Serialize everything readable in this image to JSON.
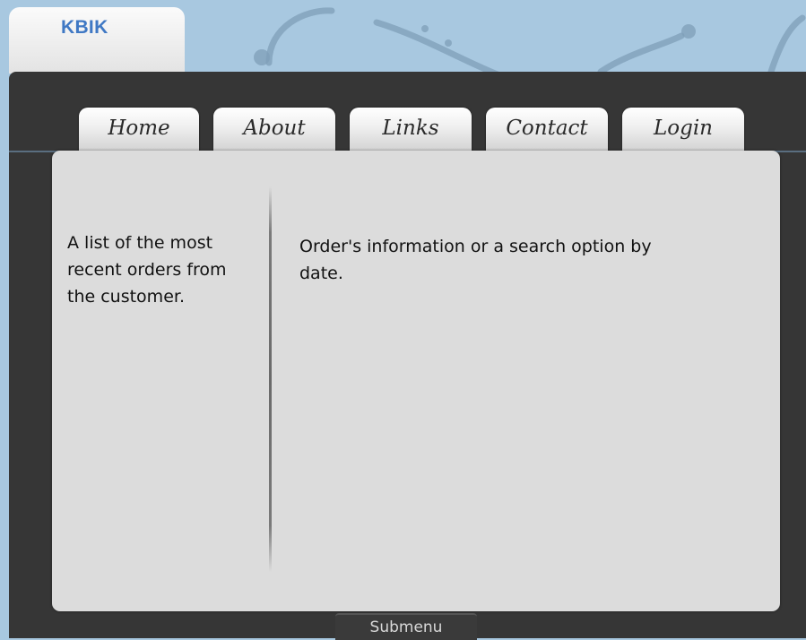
{
  "logo": {
    "text": "KBIK"
  },
  "nav": {
    "tabs": [
      {
        "label": "Home"
      },
      {
        "label": "About"
      },
      {
        "label": "Links"
      },
      {
        "label": "Contact"
      },
      {
        "label": "Login"
      }
    ]
  },
  "content": {
    "sidebar_text": "A list of the most recent orders from the customer.",
    "main_text": "Order's information or a search option by date."
  },
  "footer": {
    "submenu_label": "Submenu"
  },
  "colors": {
    "sky": "#a8c8e0",
    "frame": "#363636",
    "panel": "#dcdcdc",
    "logo_text": "#3f78c4"
  }
}
